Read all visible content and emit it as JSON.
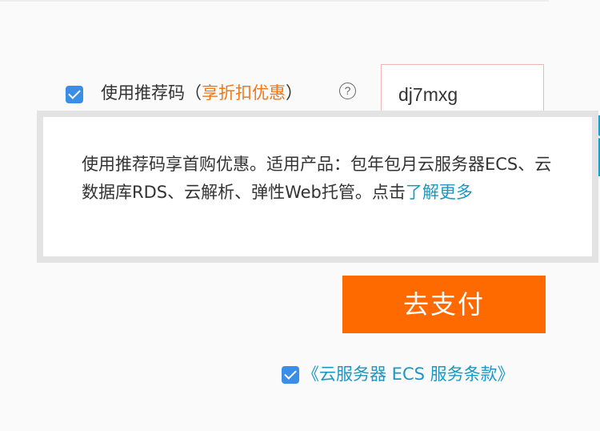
{
  "referral": {
    "checked": true,
    "label_main": "使用推荐码",
    "paren_open": "（",
    "promo_text": "享折扣优惠",
    "paren_close": "）",
    "help_glyph": "?",
    "code_value": "dj7mxg"
  },
  "tooltip": {
    "text": "使用推荐码享首购优惠。适用产品：包年包月云服务器ECS、云数据库RDS、云解析、弹性Web托管。点击",
    "link_text": "了解更多"
  },
  "pay_button": {
    "label": "去支付"
  },
  "terms": {
    "checked": true,
    "link_text": "《云服务器 ECS 服务条款》"
  },
  "colors": {
    "accent_orange": "#ff6a00",
    "promo_orange": "#f07819",
    "link_blue": "#1b97c4",
    "checkbox_blue": "#3a8ee6",
    "side_widget_blue": "#1a9ecf"
  },
  "icons": {
    "help": "question-circle-icon",
    "checkbox": "check-icon",
    "side_widget": "headset-icon"
  }
}
